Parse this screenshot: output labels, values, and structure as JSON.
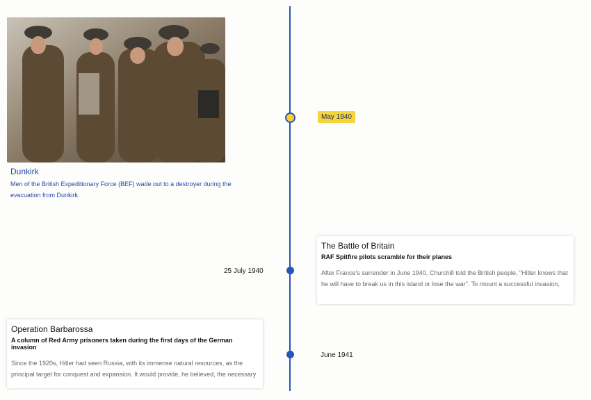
{
  "events": [
    {
      "date": "May 1940",
      "title": "Dunkirk",
      "caption": "Men of the British Expeditionary Force (BEF) wade out to a destroyer during the evacuation from Dunkirk."
    },
    {
      "date": "25 July 1940",
      "title": "The Battle of Britain",
      "subtitle": "RAF Spitfire pilots scramble for their planes",
      "body": "After France's surrender in June 1940, Churchill told the British people, \"Hitler knows that he will have to break us in this island or lose the war\". To mount a successful invasion, the"
    },
    {
      "date": "June 1941",
      "title": "Operation Barbarossa",
      "subtitle": "A column of Red Army prisoners taken during the first days of the German invasion",
      "body": "Since the 1920s, Hitler had seen Russia, with its immense natural resources, as the principal target for conquest and expansion. It would provide, he believed, the necessary"
    }
  ],
  "colors": {
    "timeline": "#2853b8",
    "badge": "#f6d53b",
    "caption": "#2349a6"
  }
}
